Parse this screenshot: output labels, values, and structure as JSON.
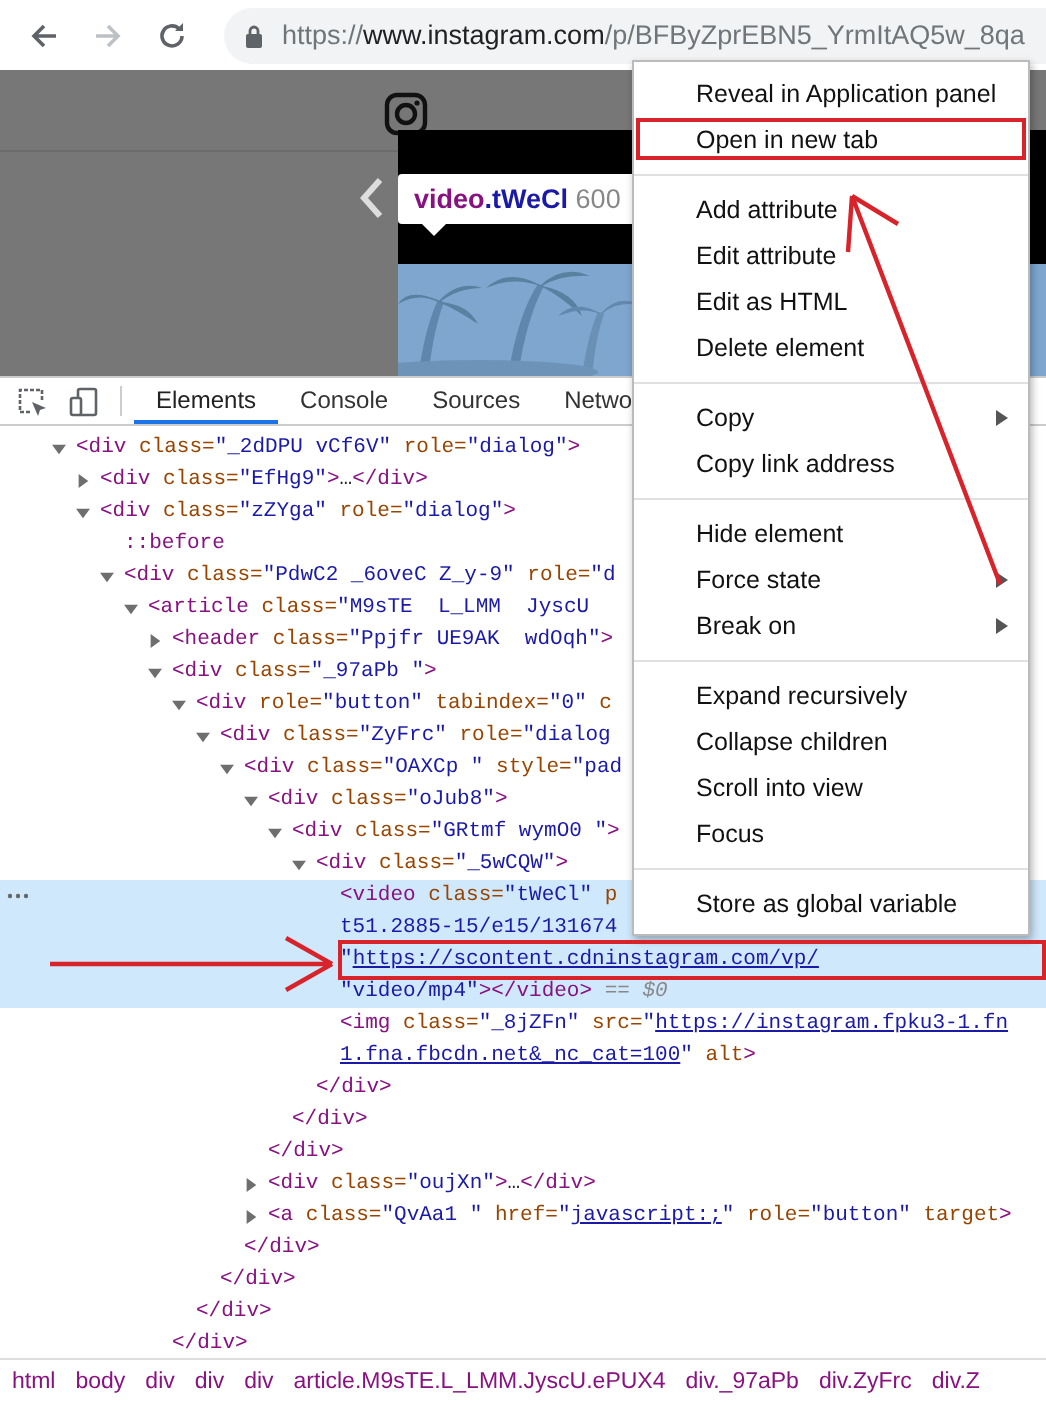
{
  "browser": {
    "forward_enabled": false,
    "url": {
      "scheme": "https://",
      "host": "www.instagram.com",
      "path": "/p/BFByZprEBN5_YrmItAQ5w_8qa"
    }
  },
  "page": {
    "tooltip": {
      "tag": "video",
      "selector": ".tWeCl",
      "size": "600"
    }
  },
  "devtools": {
    "tabs": [
      {
        "label": "Elements",
        "selected": true
      },
      {
        "label": "Console",
        "selected": false
      },
      {
        "label": "Sources",
        "selected": false
      },
      {
        "label": "Netwo",
        "selected": false
      }
    ],
    "dom": [
      {
        "lines": [
          {
            "tokens": [
              {
                "kind": "tag",
                "text": "<div"
              },
              {
                "kind": "attr",
                "text": " class="
              },
              {
                "kind": "value",
                "text": "\"_2dDPU vCf6V\""
              },
              {
                "kind": "attr",
                "text": " role="
              },
              {
                "kind": "value",
                "text": "\"dialog\""
              },
              {
                "kind": "tag",
                "text": ">"
              }
            ]
          }
        ],
        "expanded": true,
        "selected": false,
        "children": [
          {
            "lines": [
              {
                "tokens": [
                  {
                    "kind": "tag",
                    "text": "<div"
                  },
                  {
                    "kind": "attr",
                    "text": " class="
                  },
                  {
                    "kind": "value",
                    "text": "\"EfHg9\""
                  },
                  {
                    "kind": "tag",
                    "text": ">"
                  },
                  {
                    "kind": "text",
                    "text": "…"
                  },
                  {
                    "kind": "tag",
                    "text": "</div>"
                  }
                ]
              }
            ],
            "expanded": false,
            "selected": false
          },
          {
            "lines": [
              {
                "tokens": [
                  {
                    "kind": "tag",
                    "text": "<div"
                  },
                  {
                    "kind": "attr",
                    "text": " class="
                  },
                  {
                    "kind": "value",
                    "text": "\"zZYga\""
                  },
                  {
                    "kind": "attr",
                    "text": " role="
                  },
                  {
                    "kind": "value",
                    "text": "\"dialog\""
                  },
                  {
                    "kind": "tag",
                    "text": ">"
                  }
                ]
              }
            ],
            "expanded": true,
            "selected": false,
            "children": [
              {
                "lines": [
                  {
                    "tokens": [
                      {
                        "kind": "pseudo",
                        "text": "::before"
                      }
                    ]
                  }
                ],
                "selected": false
              },
              {
                "lines": [
                  {
                    "tokens": [
                      {
                        "kind": "tag",
                        "text": "<div"
                      },
                      {
                        "kind": "attr",
                        "text": " class="
                      },
                      {
                        "kind": "value",
                        "text": "\"PdwC2 _6oveC Z_y-9\""
                      },
                      {
                        "kind": "attr",
                        "text": " role="
                      },
                      {
                        "kind": "value",
                        "text": "\"d"
                      }
                    ]
                  }
                ],
                "expanded": true,
                "selected": false,
                "children": [
                  {
                    "lines": [
                      {
                        "tokens": [
                          {
                            "kind": "tag",
                            "text": "<article"
                          },
                          {
                            "kind": "attr",
                            "text": " class="
                          },
                          {
                            "kind": "value",
                            "text": "\"M9sTE  L_LMM  JyscU "
                          }
                        ]
                      }
                    ],
                    "expanded": true,
                    "selected": false,
                    "children": [
                      {
                        "lines": [
                          {
                            "tokens": [
                              {
                                "kind": "tag",
                                "text": "<header"
                              },
                              {
                                "kind": "attr",
                                "text": " class="
                              },
                              {
                                "kind": "value",
                                "text": "\"Ppjfr UE9AK  wdOqh\""
                              },
                              {
                                "kind": "tag",
                                "text": ">"
                              }
                            ]
                          }
                        ],
                        "expanded": false,
                        "selected": false
                      },
                      {
                        "lines": [
                          {
                            "tokens": [
                              {
                                "kind": "tag",
                                "text": "<div"
                              },
                              {
                                "kind": "attr",
                                "text": " class="
                              },
                              {
                                "kind": "value",
                                "text": "\"_97aPb \""
                              },
                              {
                                "kind": "tag",
                                "text": ">"
                              }
                            ]
                          }
                        ],
                        "expanded": true,
                        "selected": false,
                        "close": [
                          {
                            "kind": "tag",
                            "text": "</div>"
                          }
                        ],
                        "children": [
                          {
                            "lines": [
                              {
                                "tokens": [
                                  {
                                    "kind": "tag",
                                    "text": "<div"
                                  },
                                  {
                                    "kind": "attr",
                                    "text": " role="
                                  },
                                  {
                                    "kind": "value",
                                    "text": "\"button\""
                                  },
                                  {
                                    "kind": "attr",
                                    "text": " tabindex="
                                  },
                                  {
                                    "kind": "value",
                                    "text": "\"0\""
                                  },
                                  {
                                    "kind": "attr",
                                    "text": " c"
                                  }
                                ]
                              }
                            ],
                            "expanded": true,
                            "selected": false,
                            "close": [
                              {
                                "kind": "tag",
                                "text": "</div>"
                              }
                            ],
                            "children": [
                              {
                                "lines": [
                                  {
                                    "tokens": [
                                      {
                                        "kind": "tag",
                                        "text": "<div"
                                      },
                                      {
                                        "kind": "attr",
                                        "text": " class="
                                      },
                                      {
                                        "kind": "value",
                                        "text": "\"ZyFrc\""
                                      },
                                      {
                                        "kind": "attr",
                                        "text": " role="
                                      },
                                      {
                                        "kind": "value",
                                        "text": "\"dialog"
                                      }
                                    ]
                                  }
                                ],
                                "expanded": true,
                                "selected": false,
                                "close": [
                                  {
                                    "kind": "tag",
                                    "text": "</div>"
                                  }
                                ],
                                "children": [
                                  {
                                    "lines": [
                                      {
                                        "tokens": [
                                          {
                                            "kind": "tag",
                                            "text": "<div"
                                          },
                                          {
                                            "kind": "attr",
                                            "text": " class="
                                          },
                                          {
                                            "kind": "value",
                                            "text": "\"OAXCp \""
                                          },
                                          {
                                            "kind": "attr",
                                            "text": " style="
                                          },
                                          {
                                            "kind": "value",
                                            "text": "\"pad"
                                          }
                                        ]
                                      }
                                    ],
                                    "expanded": true,
                                    "selected": false,
                                    "close": [
                                      {
                                        "kind": "tag",
                                        "text": "</div>"
                                      }
                                    ],
                                    "children": [
                                      {
                                        "lines": [
                                          {
                                            "tokens": [
                                              {
                                                "kind": "tag",
                                                "text": "<div"
                                              },
                                              {
                                                "kind": "attr",
                                                "text": " class="
                                              },
                                              {
                                                "kind": "value",
                                                "text": "\"oJub8\""
                                              },
                                              {
                                                "kind": "tag",
                                                "text": ">"
                                              }
                                            ]
                                          }
                                        ],
                                        "expanded": true,
                                        "selected": false,
                                        "close": [
                                          {
                                            "kind": "tag",
                                            "text": "</div>"
                                          }
                                        ],
                                        "children": [
                                          {
                                            "lines": [
                                              {
                                                "tokens": [
                                                  {
                                                    "kind": "tag",
                                                    "text": "<div"
                                                  },
                                                  {
                                                    "kind": "attr",
                                                    "text": " class="
                                                  },
                                                  {
                                                    "kind": "value",
                                                    "text": "\"GRtmf wymO0 \""
                                                  },
                                                  {
                                                    "kind": "tag",
                                                    "text": ">"
                                                  }
                                                ]
                                              }
                                            ],
                                            "expanded": true,
                                            "selected": false,
                                            "close": [
                                              {
                                                "kind": "tag",
                                                "text": "</div>"
                                              }
                                            ],
                                            "children": [
                                              {
                                                "lines": [
                                                  {
                                                    "tokens": [
                                                      {
                                                        "kind": "tag",
                                                        "text": "<div"
                                                      },
                                                      {
                                                        "kind": "attr",
                                                        "text": " class="
                                                      },
                                                      {
                                                        "kind": "value",
                                                        "text": "\"_5wCQW\""
                                                      },
                                                      {
                                                        "kind": "tag",
                                                        "text": ">"
                                                      }
                                                    ]
                                                  }
                                                ],
                                                "expanded": true,
                                                "selected": false,
                                                "close": [
                                                  {
                                                    "kind": "tag",
                                                    "text": "</div>"
                                                  }
                                                ],
                                                "children": [
                                                  {
                                                    "lines": [
                                                      {
                                                        "tokens": [
                                                          {
                                                            "kind": "tag",
                                                            "text": "<video"
                                                          },
                                                          {
                                                            "kind": "attr",
                                                            "text": " class="
                                                          },
                                                          {
                                                            "kind": "value",
                                                            "text": "\"tWeCl\""
                                                          },
                                                          {
                                                            "kind": "attr",
                                                            "text": " p"
                                                          }
                                                        ]
                                                      },
                                                      {
                                                        "tokens": [
                                                          {
                                                            "kind": "value",
                                                            "text": "t51.2885-15/e15/131674"
                                                          }
                                                        ]
                                                      },
                                                      {
                                                        "tokens": [
                                                          {
                                                            "kind": "value",
                                                            "text": "\""
                                                          },
                                                          {
                                                            "kind": "link",
                                                            "text": "https://scontent.cdninstagram.com/vp/"
                                                          }
                                                        ]
                                                      },
                                                      {
                                                        "tokens": [
                                                          {
                                                            "kind": "value",
                                                            "text": "\"video/mp4\""
                                                          },
                                                          {
                                                            "kind": "tag",
                                                            "text": "></video>"
                                                          },
                                                          {
                                                            "kind": "eq",
                                                            "text": " == $0"
                                                          }
                                                        ]
                                                      }
                                                    ],
                                                    "selected": true
                                                  },
                                                  {
                                                    "lines": [
                                                      {
                                                        "tokens": [
                                                          {
                                                            "kind": "tag",
                                                            "text": "<img"
                                                          },
                                                          {
                                                            "kind": "attr",
                                                            "text": " class="
                                                          },
                                                          {
                                                            "kind": "value",
                                                            "text": "\"_8jZFn\""
                                                          },
                                                          {
                                                            "kind": "attr",
                                                            "text": " src="
                                                          },
                                                          {
                                                            "kind": "value",
                                                            "text": "\""
                                                          },
                                                          {
                                                            "kind": "link",
                                                            "text": "https://instagram.fpku3-1.fn"
                                                          }
                                                        ]
                                                      },
                                                      {
                                                        "tokens": [
                                                          {
                                                            "kind": "link",
                                                            "text": "1.fna.fbcdn.net&_nc_cat=100"
                                                          },
                                                          {
                                                            "kind": "value",
                                                            "text": "\""
                                                          },
                                                          {
                                                            "kind": "attr",
                                                            "text": " alt"
                                                          },
                                                          {
                                                            "kind": "tag",
                                                            "text": ">"
                                                          }
                                                        ]
                                                      }
                                                    ],
                                                    "selected": false
                                                  }
                                                ]
                                              }
                                            ]
                                          }
                                        ]
                                      },
                                      {
                                        "lines": [
                                          {
                                            "tokens": [
                                              {
                                                "kind": "tag",
                                                "text": "<div"
                                              },
                                              {
                                                "kind": "attr",
                                                "text": " class="
                                              },
                                              {
                                                "kind": "value",
                                                "text": "\"oujXn\""
                                              },
                                              {
                                                "kind": "tag",
                                                "text": ">"
                                              },
                                              {
                                                "kind": "text",
                                                "text": "…"
                                              },
                                              {
                                                "kind": "tag",
                                                "text": "</div>"
                                              }
                                            ]
                                          }
                                        ],
                                        "expanded": false,
                                        "selected": false
                                      },
                                      {
                                        "lines": [
                                          {
                                            "tokens": [
                                              {
                                                "kind": "tag",
                                                "text": "<a"
                                              },
                                              {
                                                "kind": "attr",
                                                "text": " class="
                                              },
                                              {
                                                "kind": "value",
                                                "text": "\"QvAa1 \""
                                              },
                                              {
                                                "kind": "attr",
                                                "text": " href="
                                              },
                                              {
                                                "kind": "value",
                                                "text": "\""
                                              },
                                              {
                                                "kind": "link",
                                                "text": "javascript:;"
                                              },
                                              {
                                                "kind": "value",
                                                "text": "\""
                                              },
                                              {
                                                "kind": "attr",
                                                "text": " role="
                                              },
                                              {
                                                "kind": "value",
                                                "text": "\"button\""
                                              },
                                              {
                                                "kind": "attr",
                                                "text": " target"
                                              },
                                              {
                                                "kind": "tag",
                                                "text": ">"
                                              }
                                            ]
                                          }
                                        ],
                                        "expanded": false,
                                        "selected": false
                                      }
                                    ]
                                  }
                                ]
                              }
                            ]
                          }
                        ]
                      }
                    ]
                  }
                ]
              }
            ]
          }
        ]
      }
    ],
    "breadcrumbs": [
      "html",
      "body",
      "div",
      "div",
      "div",
      "article.M9sTE.L_LMM.JyscU.ePUX4",
      "div._97aPb",
      "div.ZyFrc",
      "div.Z"
    ]
  },
  "context_menu": {
    "groups": [
      [
        {
          "label": "Reveal in Application panel",
          "submenu": false,
          "annotated": false
        },
        {
          "label": "Open in new tab",
          "submenu": false,
          "annotated": true
        }
      ],
      [
        {
          "label": "Add attribute",
          "submenu": false,
          "annotated": false
        },
        {
          "label": "Edit attribute",
          "submenu": false,
          "annotated": false
        },
        {
          "label": "Edit as HTML",
          "submenu": false,
          "annotated": false
        },
        {
          "label": "Delete element",
          "submenu": false,
          "annotated": false
        }
      ],
      [
        {
          "label": "Copy",
          "submenu": true,
          "annotated": false
        },
        {
          "label": "Copy link address",
          "submenu": false,
          "annotated": false
        }
      ],
      [
        {
          "label": "Hide element",
          "submenu": false,
          "annotated": false
        },
        {
          "label": "Force state",
          "submenu": true,
          "annotated": false
        },
        {
          "label": "Break on",
          "submenu": true,
          "annotated": false
        }
      ],
      [
        {
          "label": "Expand recursively",
          "submenu": false,
          "annotated": false
        },
        {
          "label": "Collapse children",
          "submenu": false,
          "annotated": false
        },
        {
          "label": "Scroll into view",
          "submenu": false,
          "annotated": false
        },
        {
          "label": "Focus",
          "submenu": false,
          "annotated": false
        }
      ],
      [
        {
          "label": "Store as global variable",
          "submenu": false,
          "annotated": false
        }
      ]
    ]
  }
}
